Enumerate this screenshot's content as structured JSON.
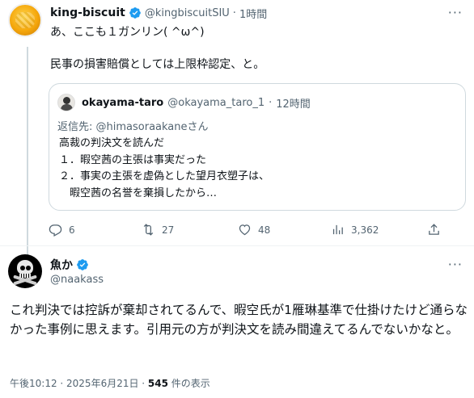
{
  "parent_tweet": {
    "name": "king-biscuit",
    "handle": "@kingbiscuitSIU",
    "separator": "·",
    "time": "1時間",
    "text": "あ、ここも１ガンリン( ^ω^)\n\n民事の損害賠償としては上限枠認定、と。",
    "more": "···"
  },
  "quoted_tweet": {
    "name": "okayama-taro",
    "handle": "@okayama_taro_1",
    "separator": "·",
    "time": "12時間",
    "reply_prefix": "返信先: ",
    "reply_to": "@himasoraakane",
    "reply_suffix": "さん",
    "body": "高裁の判決文を読んだ\n１．暇空茜の主張は事実だった\n２．事実の主張を虚偽とした望月衣塑子は、\n　暇空茜の名誉を棄損したから…"
  },
  "actions": {
    "replies": "6",
    "retweets": "27",
    "likes": "48",
    "views": "3,362"
  },
  "main_tweet": {
    "name": "魚か",
    "handle": "@naakass",
    "more": "···",
    "text": "これ判決では控訴が棄却されてるんで、暇空氏が1雁琳基準で仕掛けたけど通らなかった事例に思えます。引用元の方が判決文を読み間違えてるんでないかなと。",
    "timestamp": "午後10:12 · 2025年6月21日 · ",
    "views_count": "545",
    "views_label": " 件の表示"
  },
  "colors": {
    "verified": "#1d9bf0",
    "secondary_text": "#536471",
    "primary_text": "#0f1419",
    "border": "#cfd9de"
  }
}
